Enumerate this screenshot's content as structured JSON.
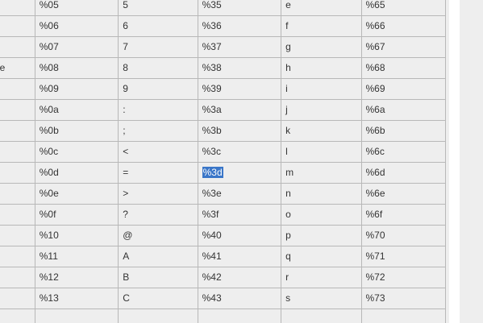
{
  "table": {
    "rows": [
      [
        "",
        "%05",
        "5",
        "%35",
        "e",
        "%65"
      ],
      [
        "",
        "%06",
        "6",
        "%36",
        "f",
        "%66"
      ],
      [
        "",
        "%07",
        "7",
        "%37",
        "g",
        "%67"
      ],
      [
        "ace",
        "%08",
        "8",
        "%38",
        "h",
        "%68"
      ],
      [
        "",
        "%09",
        "9",
        "%39",
        "i",
        "%69"
      ],
      [
        "",
        "%0a",
        ":",
        "%3a",
        "j",
        "%6a"
      ],
      [
        "",
        "%0b",
        ";",
        "%3b",
        "k",
        "%6b"
      ],
      [
        "",
        "%0c",
        "<",
        "%3c",
        "l",
        "%6c"
      ],
      [
        "",
        "%0d",
        "=",
        "%3d",
        "m",
        "%6d"
      ],
      [
        "",
        "%0e",
        ">",
        "%3e",
        "n",
        "%6e"
      ],
      [
        "",
        "%0f",
        "?",
        "%3f",
        "o",
        "%6f"
      ],
      [
        "",
        "%10",
        "@",
        "%40",
        "p",
        "%70"
      ],
      [
        "",
        "%11",
        "A",
        "%41",
        "q",
        "%71"
      ],
      [
        "",
        "%12",
        "B",
        "%42",
        "r",
        "%72"
      ],
      [
        "",
        "%13",
        "C",
        "%43",
        "s",
        "%73"
      ],
      [
        "",
        "",
        "",
        "",
        "",
        ""
      ]
    ],
    "selection": {
      "row": 8,
      "col": 3
    }
  },
  "colors": {
    "cell_background": "#eeeeee",
    "cell_border": "#b8b8b8",
    "selection_background": "#3a76c8",
    "selection_text": "#ffffff"
  }
}
